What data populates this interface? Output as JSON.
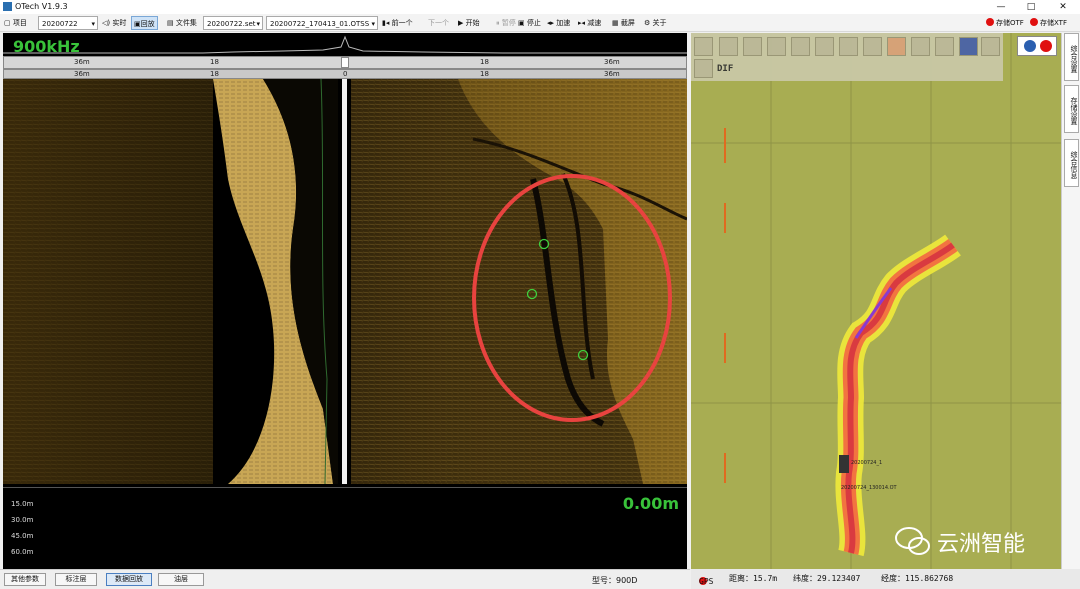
{
  "window": {
    "title": "OTech V1.9.3",
    "minimize": "—",
    "maximize": "□",
    "close": "✕"
  },
  "toolbar": {
    "project_label": "项目",
    "project_value": "20200722",
    "realtime_label": "实时",
    "replay_label": "回放",
    "fileset_label": "文件集",
    "fileset_value": "20200722.set",
    "file_value": "20200722_170413_01.OTSS",
    "prev_label": "前一个",
    "next_label": "下一个",
    "start_label": "开始",
    "pause_label": "暂停",
    "stop_label": "停止",
    "speedup_label": "加速",
    "slowdown_label": "减速",
    "screenshot_label": "截屏",
    "about_label": "关于",
    "save_otf_label": "存储OTF",
    "save_xtf_label": "存储XTF"
  },
  "sonar": {
    "frequency": "900kHz",
    "ruler_top": [
      "36m",
      "18",
      "0",
      "18",
      "36m"
    ],
    "ruler_bottom": [
      "36m",
      "18",
      "0",
      "18",
      "36m"
    ],
    "depth_labels": [
      "15.0m",
      "30.0m",
      "45.0m",
      "60.0m"
    ],
    "depth_value": "0.00m"
  },
  "bottombar": {
    "buttons": [
      "其他参数",
      "标注层",
      "数据回放",
      "油层"
    ],
    "model": "型号：900D"
  },
  "map": {
    "tool_dif_label": "DIF",
    "track_label_1": "20200724_1",
    "track_label_2": "20200724_130014.OT"
  },
  "status": {
    "gps_label": "GPS",
    "range": "距离：15.7m",
    "latitude": "纬度：29.123407",
    "longitude": "经度：115.862768"
  },
  "rightbar": {
    "tabs": [
      "综合设置",
      "存储设置",
      "综合信息"
    ]
  },
  "watermark": {
    "text": "云洲智能"
  },
  "colors": {
    "accent_green": "#39c23a",
    "highlight_red": "#e8433f",
    "map_bg": "#a8ad52"
  }
}
